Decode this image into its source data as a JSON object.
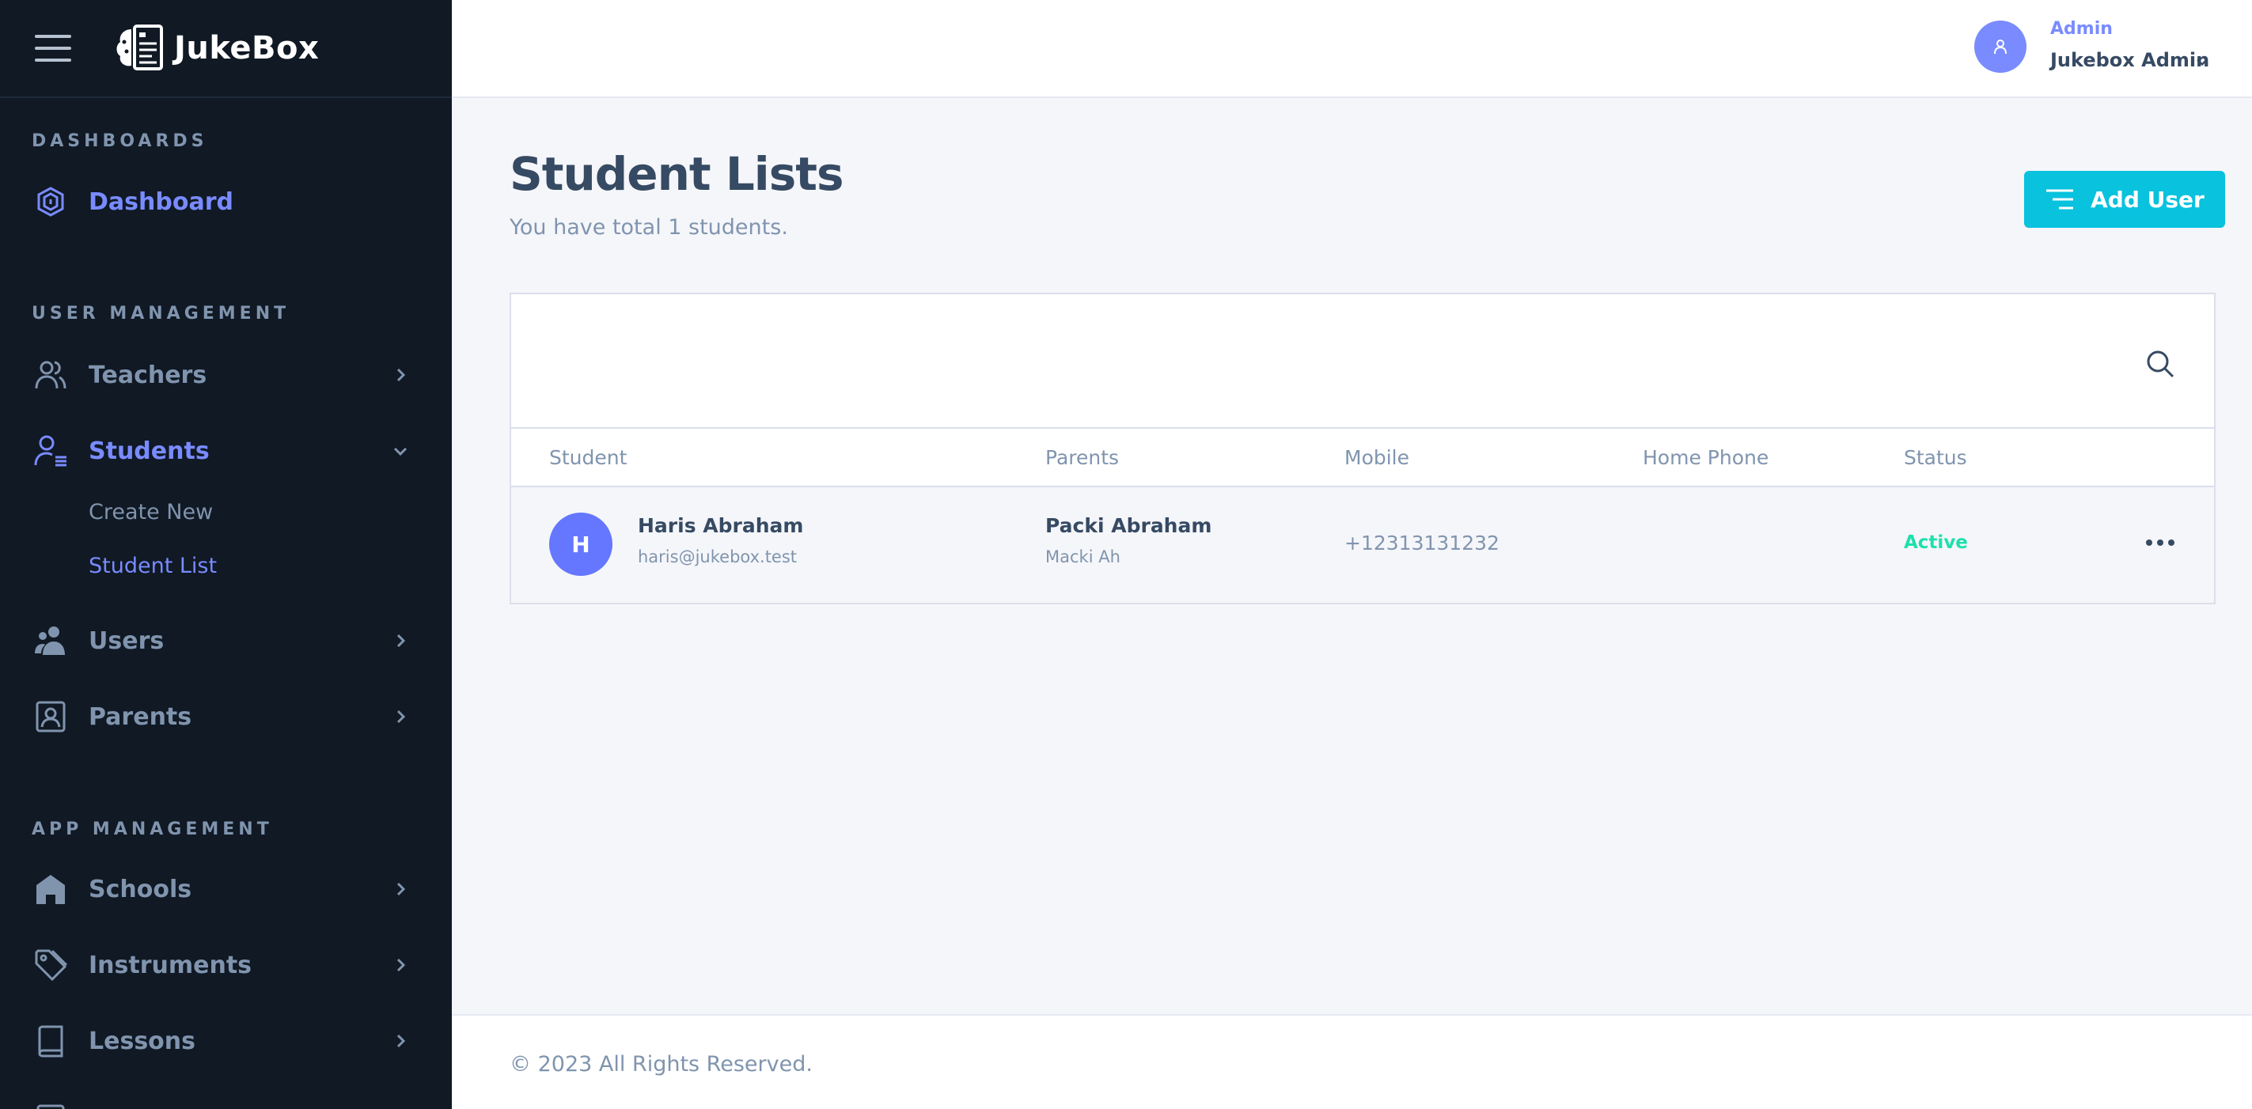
{
  "brand": {
    "name": "JukeBox"
  },
  "sidebar": {
    "sections": [
      "DASHBOARDS",
      "USER MANAGEMENT",
      "APP MANAGEMENT"
    ],
    "items": [
      {
        "label": "Dashboard",
        "icon": "dashboard-icon"
      },
      {
        "label": "Teachers",
        "icon": "teachers-icon"
      },
      {
        "label": "Students",
        "icon": "students-icon"
      },
      {
        "label": "Users",
        "icon": "users-icon"
      },
      {
        "label": "Parents",
        "icon": "parents-icon"
      },
      {
        "label": "Schools",
        "icon": "school-icon"
      },
      {
        "label": "Instruments",
        "icon": "tag-icon"
      },
      {
        "label": "Lessons",
        "icon": "book-icon"
      }
    ],
    "students_sub": [
      "Create New",
      "Student List"
    ]
  },
  "header": {
    "user_role": "Admin",
    "user_name": "Jukebox Admin"
  },
  "page": {
    "title": "Student Lists",
    "subtitle": "You have total 1 students.",
    "add_button": "Add User"
  },
  "table": {
    "columns": [
      "Student",
      "Parents",
      "Mobile",
      "Home Phone",
      "Status"
    ],
    "rows": [
      {
        "initial": "H",
        "student_name": "Haris Abraham",
        "student_email": "haris@jukebox.test",
        "parent_name": "Packi Abraham",
        "parent_sub": "Macki Ah",
        "mobile": "+12313131232",
        "home_phone": "",
        "status": "Active"
      }
    ]
  },
  "footer": {
    "text": "© 2023 All Rights Reserved."
  },
  "colors": {
    "sidebar_bg": "#101924",
    "accent": "#798bff",
    "button": "#09c2de",
    "status_active": "#1ee0ac"
  }
}
